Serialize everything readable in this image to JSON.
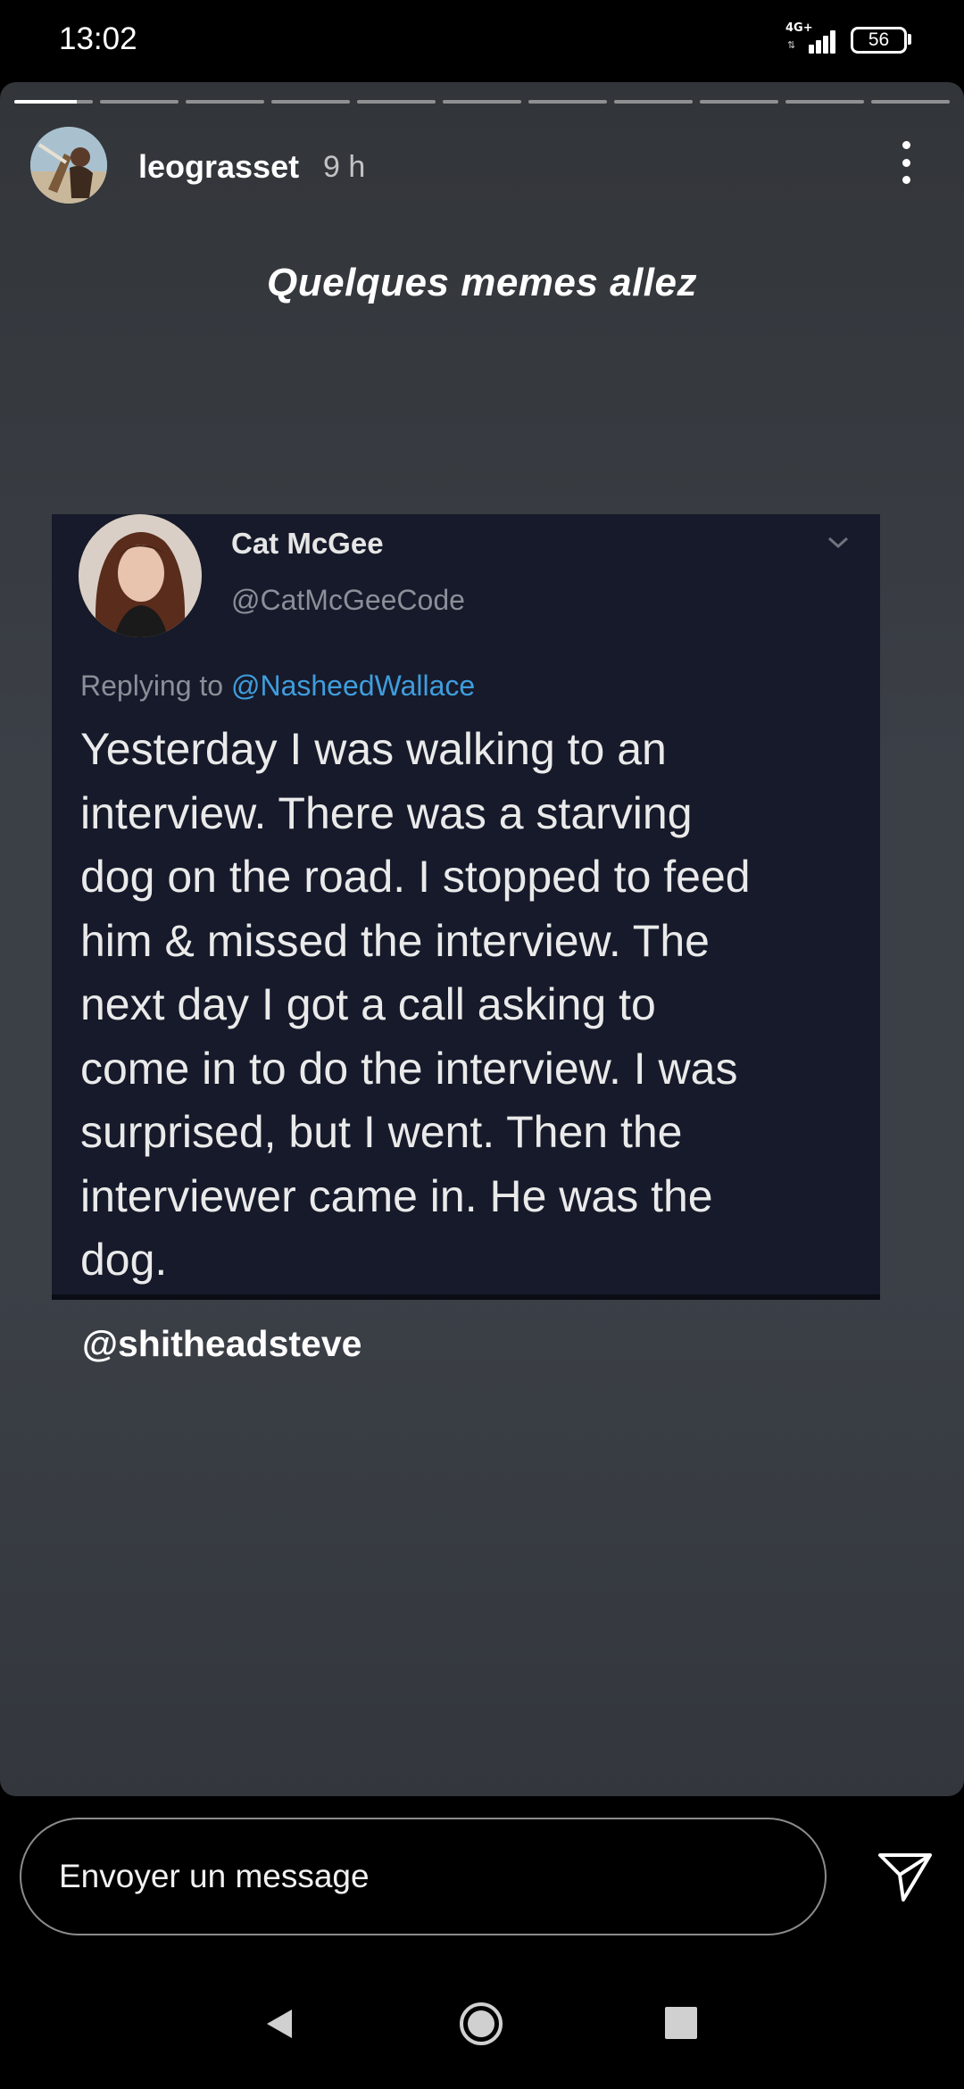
{
  "status_bar": {
    "time": "13:02",
    "network": "4G+",
    "battery": "56"
  },
  "story": {
    "progress": {
      "segments": 11,
      "current_index": 0,
      "current_fill": 0.8
    },
    "username": "leograsset",
    "time_ago": "9 h",
    "more_icon": "more-vertical-icon",
    "caption": "Quelques memes allez",
    "tag": "@shitheadsteve",
    "tweet": {
      "name": "Cat McGee",
      "handle": "@CatMcGeeCode",
      "replying_prefix": "Replying to",
      "replying_mention": "@NasheedWallace",
      "lines": [
        "Yesterday I was walking to an",
        "interview. There was a starving",
        "dog on the road. I stopped to feed",
        "him & missed the interview. The",
        "next day I got a call asking to",
        "come in to do the interview. I was",
        "surprised, but I went. Then the",
        "interviewer came in. He was the",
        "dog."
      ]
    }
  },
  "message_bar": {
    "placeholder": "Envoyer un message",
    "send_icon": "send-icon"
  },
  "nav_bar": {
    "back_icon": "back-triangle-icon",
    "home_icon": "home-circle-icon",
    "recents_icon": "recents-square-icon"
  },
  "colors": {
    "mention_blue": "#3f9ddd",
    "tweet_bg": "#161a2a",
    "story_bg": "#3b3f46"
  }
}
